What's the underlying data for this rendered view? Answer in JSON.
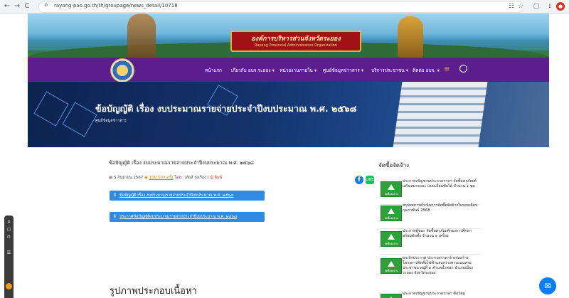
{
  "browser": {
    "url": "rayong-pao.go.th/th/groupage/news_detail/10718",
    "back_glyph": "←",
    "forward_glyph": "→",
    "reload_glyph": "C",
    "tabs_glyph": "☷",
    "star_glyph": "☆",
    "panel_glyph": "▢",
    "download_glyph": "⭳",
    "profile_glyph": "●"
  },
  "header": {
    "title_thai": "องค์การบริหารส่วนจังหวัดระยอง",
    "title_en": "Rayong Provincial Administrative Organization",
    "nav": [
      {
        "label": "หน้าแรก"
      },
      {
        "label": "เกี่ยวกับ อบจ.ระยอง ▾"
      },
      {
        "label": "หน่วยงานภายใน ▾"
      },
      {
        "label": "ศูนย์ข้อมูลข่าวสาร ▾"
      },
      {
        "label": "บริการประชาชน ▾"
      },
      {
        "label": "ติดต่อ อบจ. ▾"
      }
    ],
    "hamburger": "≡"
  },
  "hero": {
    "title": "ข้อบัญญัติ เรื่อง งบประมาณรายจ่ายประจำปีงบประมาณ พ.ศ. ๒๕๖๘",
    "subtitle": "ศูนย์ข้อมูลข่าวสาร"
  },
  "article": {
    "title": "ข้อบัญญัติ เรื่อง งบประมาณรายจ่ายประจำปีงบประมาณ พ.ศ. ๒๕๖๘",
    "date": "5 กันยายน 2567",
    "views": "100,503 ครั้ง",
    "author": "โดย: วลัยส์ รุ่งเรือง",
    "print": "พิมพ์",
    "downloads": [
      {
        "label": "ข้อบัญญัติ เรื่อง งบประมาณรายจ่ายประจำปีงบประมาณ พ.ศ. ๒๕๖๘"
      },
      {
        "label": "ประกาศข้อบัญญัติงบประมาณรายจ่ายประจำปีงบประมาณ พ.ศ. ๒๕๖๘"
      }
    ],
    "gallery_title": "รูปภาพประกอบเนื้อหา"
  },
  "share": {
    "fb": "f",
    "line": "LINE"
  },
  "sidebar": {
    "title": "จัดซื้อจัดจ้าง",
    "thumb_label": "จัดซื้อจัดจ้าง",
    "items": [
      {
        "text": "ประกาศเชิญชวนประกวดราคา จัดซื้อครุภัณฑ์เสริมสมรรถนะ แบบเลื่อนพับได้ จำนวน ๑ ชุด"
      },
      {
        "text": "สรุปผลการดำเนินการจัดซื้อจัดจ้างในรอบเดือน กุมภาพันธ์ 2568"
      },
      {
        "text": "ประกาศผู้ชนะ จัดซื้อครุภัณฑ์กองการศึกษา พร้อมติดตั้ง จำนวน ๑ เครื่อง"
      },
      {
        "text": "ยกเลิกประกาศ ประกวดราคาจ้างก่อสร้างโครงการติดตั้งไฟฟ้าแสงสว่างทางถนนสายประชาชน หมู่ที่ ๓ ตำบลน้ำคอก อำเภอเมือง ระยอง จังหวัดระยอง"
      },
      {
        "text": "ประกาศเชิญชวนประกวดราคา ซื้อวัสดุ"
      }
    ]
  },
  "dock": [
    "⌂",
    "▢",
    "⊓",
    "☰"
  ],
  "messenger_glyph": "✉"
}
